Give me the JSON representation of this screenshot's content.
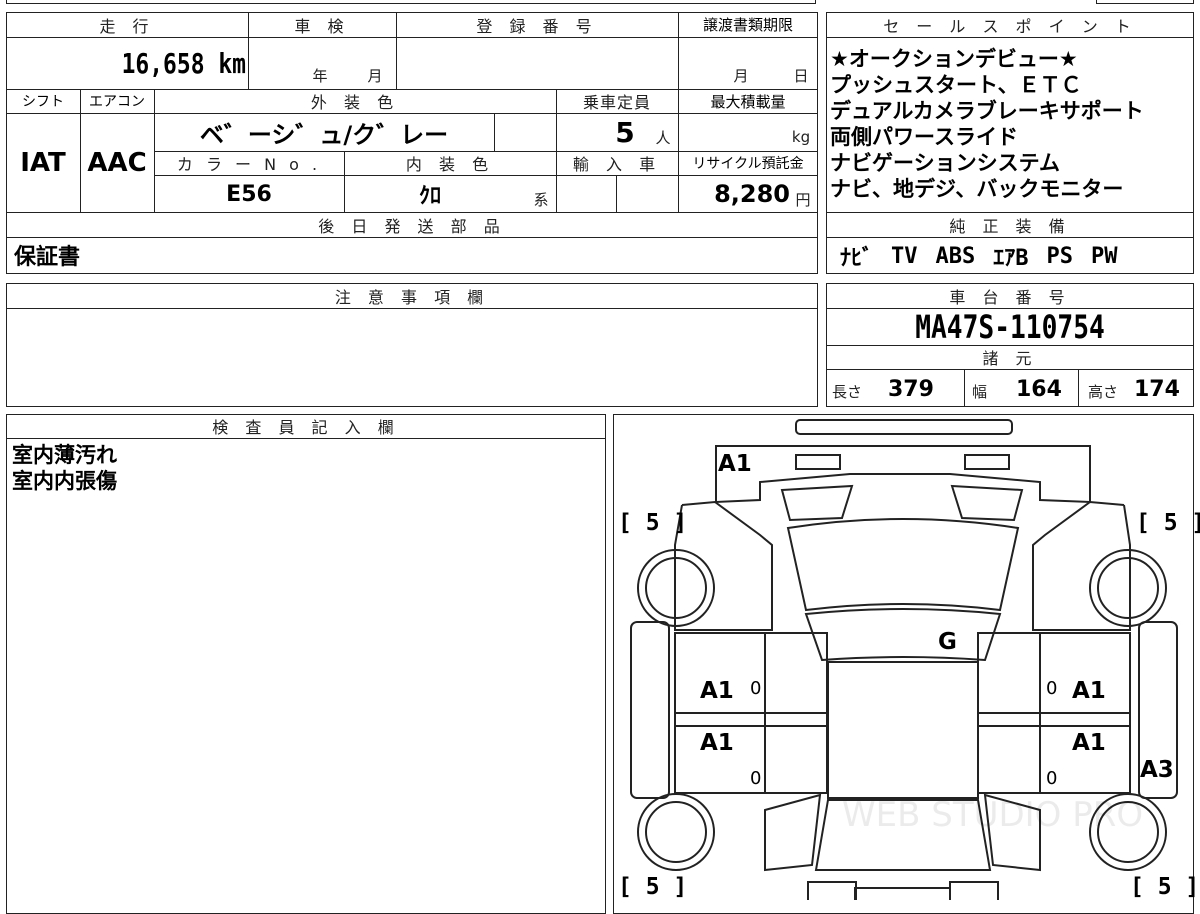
{
  "vehicle": {
    "mileage_header": "走 行",
    "mileage": "16,658 km",
    "inspection_header": "車 検",
    "inspection_year": "年",
    "inspection_month": "月",
    "registration_header": "登 録 番 号",
    "registration_value": "",
    "transfer_header": "譲渡書類期限",
    "transfer_month": "月",
    "transfer_day": "日",
    "shift_header": "シフト",
    "shift": "IAT",
    "ac_header": "エアコン",
    "ac": "AAC",
    "exterior_color_header": "外 装 色",
    "exterior_color": "ベ゛ーシ゛ュ/ク゛レー",
    "capacity_header": "乗車定員",
    "capacity": "5",
    "capacity_unit": "人",
    "max_load_header": "最大積載量",
    "max_load_unit": "kg",
    "color_no_header": "カ ラ ー N o .",
    "color_no": "E56",
    "interior_color_header": "内 装 色",
    "interior_color": "ｸﾛ",
    "interior_suffix": "系",
    "import_header": "輸 入 車",
    "recycle_header": "リサイクル預託金",
    "recycle_fee": "8,280",
    "recycle_unit": "円"
  },
  "later_parts": {
    "header": "後 日 発 送 部 品",
    "value": "保証書"
  },
  "sales_points": {
    "header": "セ ー ル ス ポ イ ン ト",
    "items": [
      "★オークションデビュー★",
      "プッシュスタート、ＥＴＣ",
      "デュアルカメラブレーキサポート",
      "両側パワースライド",
      "ナビゲーションシステム",
      "ナビ、地デジ、バックモニター"
    ]
  },
  "equipment": {
    "header": "純 正 装 備",
    "items": [
      "ﾅﾋﾞ",
      "TV",
      "ABS",
      "ｴｱB",
      "PS",
      "PW"
    ]
  },
  "notes": {
    "header": "注 意 事 項 欄",
    "value": ""
  },
  "chassis": {
    "header": "車 台 番 号",
    "value": "MA47S-110754"
  },
  "dimensions": {
    "header": "諸 元",
    "length_label": "長さ",
    "length": "379",
    "width_label": "幅",
    "width": "164",
    "height_label": "高さ",
    "height": "174"
  },
  "inspector": {
    "header": "検 査 員 記 入 欄",
    "lines": [
      "室内薄汚れ",
      "室内内張傷"
    ]
  },
  "diagram": {
    "marks": [
      "A1",
      "G",
      "A1",
      "A1",
      "A1",
      "A1",
      "A3"
    ],
    "tires": [
      "[ 5 ]",
      "[ 5 ]",
      "[ 5 ]",
      "[ 5 ]"
    ],
    "zeros": [
      "0",
      "0",
      "0",
      "0"
    ],
    "watermark": "WEB STUDIO PRO"
  }
}
